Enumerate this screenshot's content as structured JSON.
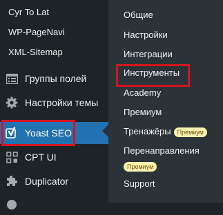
{
  "sidebar": {
    "plugin_links": [
      "Cyr To Lat",
      "WP-PageNavi",
      "XML-Sitemap"
    ],
    "items": [
      {
        "label": "Группы полей",
        "icon": "table-icon"
      },
      {
        "label": "Настройки темы",
        "icon": "gear-icon"
      },
      {
        "label": "Yoast SEO",
        "icon": "yoast-icon"
      },
      {
        "label": "CPT UI",
        "icon": "grid-icon"
      },
      {
        "label": "Duplicator",
        "icon": "puzzle-icon"
      }
    ]
  },
  "submenu": {
    "items": [
      {
        "label": "Общие"
      },
      {
        "label": "Настройки"
      },
      {
        "label": "Интеграции"
      },
      {
        "label": "Инструменты"
      },
      {
        "label": "Academy"
      },
      {
        "label": "Премиум"
      },
      {
        "label": "Тренажёры",
        "badge": "Премиум"
      },
      {
        "label": "Перенаправления",
        "badge": "Премиум"
      },
      {
        "label": "Support"
      }
    ]
  },
  "colors": {
    "sidebar_bg": "#1d2327",
    "submenu_bg": "#2c3338",
    "active_bg": "#2271b1",
    "highlight_border": "#d4141f",
    "badge_bg": "#fff3b0"
  }
}
